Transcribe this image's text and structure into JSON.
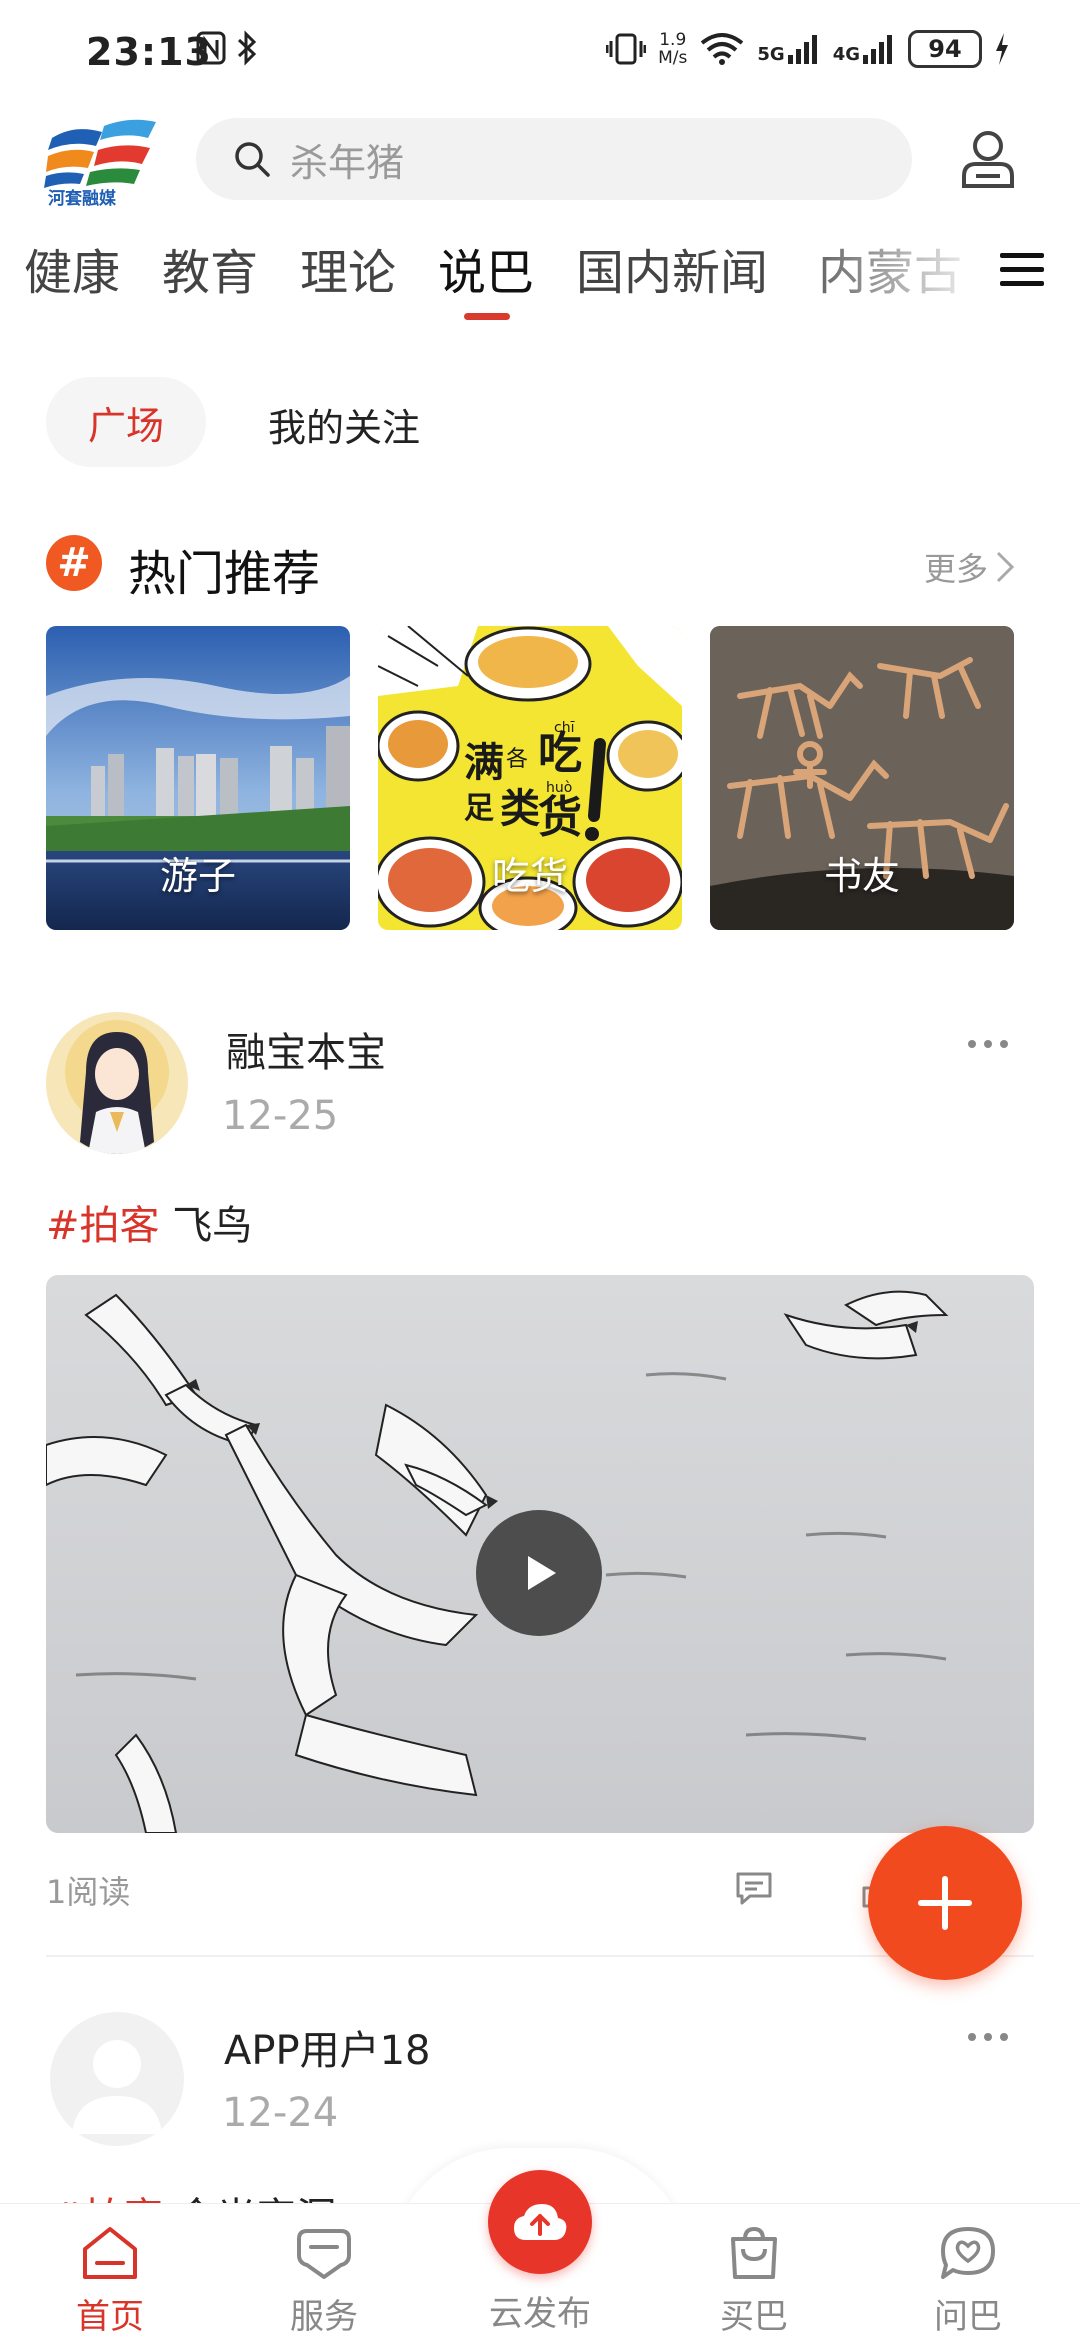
{
  "status_bar": {
    "time": "23:13",
    "left_icons": [
      "nfc-icon",
      "bluetooth-icon"
    ],
    "net_speed_value": "1.9",
    "net_speed_unit": "M/s",
    "network_labels": [
      "5G",
      "4G"
    ],
    "battery": "94"
  },
  "header": {
    "logo_text": "河套融媒",
    "search_placeholder": "杀年猪",
    "icons": [
      "search-icon",
      "user-icon"
    ]
  },
  "channel_tabs": {
    "items": [
      "健康",
      "教育",
      "理论",
      "说巴",
      "国内新闻",
      "内蒙古"
    ],
    "active": "说巴"
  },
  "sub_tabs": {
    "plaza": "广场",
    "following": "我的关注"
  },
  "hot_section": {
    "icon_glyph": "#",
    "title": "热门推荐",
    "more": "更多",
    "cards": [
      {
        "label": "游子"
      },
      {
        "label": "吃货"
      },
      {
        "label": "书友"
      }
    ],
    "food_poster": {
      "line1": "满",
      "line2": "各",
      "line3": "足",
      "line4": "类",
      "pinyin1": "chī",
      "pinyin2": "huò",
      "big1": "吃",
      "big2": "货"
    }
  },
  "posts": [
    {
      "author": "融宝本宝",
      "date": "12-25",
      "tag": "#拍客",
      "text": "飞鸟",
      "read_count": "1阅读"
    },
    {
      "author": "APP用户18",
      "date": "12-24",
      "tag": "#拍客",
      "text": "金光穿洞"
    }
  ],
  "fab": {
    "icon": "plus-icon"
  },
  "bottom_nav": {
    "items": [
      {
        "label": "首页",
        "icon": "home-icon",
        "active": true
      },
      {
        "label": "服务",
        "icon": "service-icon",
        "active": false
      },
      {
        "label": "云发布",
        "icon": "cloud-upload-icon",
        "active": false
      },
      {
        "label": "买巴",
        "icon": "shopping-bag-icon",
        "active": false
      },
      {
        "label": "问巴",
        "icon": "chat-heart-icon",
        "active": false
      }
    ]
  },
  "colors": {
    "accent": "#d8342a",
    "fab": "#f24a1f",
    "hot_icon": "#f05a22",
    "logo_blue": "#1f5fb4"
  }
}
